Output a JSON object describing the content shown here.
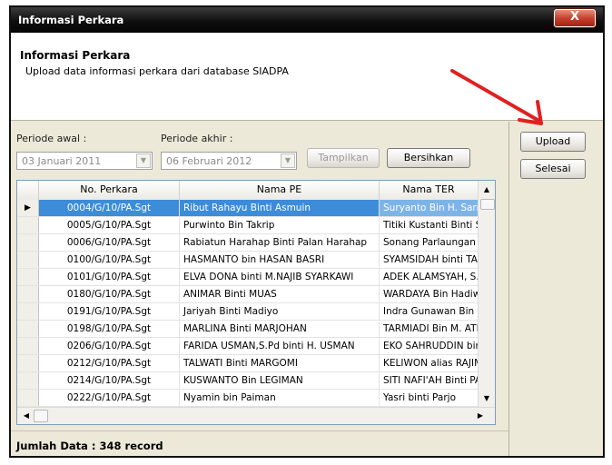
{
  "window": {
    "title": "Informasi Perkara",
    "close_glyph": "X"
  },
  "header": {
    "title": "Informasi Perkara",
    "subtitle": "Upload data informasi perkara dari database SIADPA"
  },
  "filters": {
    "periode_awal_label": "Periode awal :",
    "periode_akhir_label": "Periode akhir :",
    "periode_awal_value": "03  Januari   2011",
    "periode_akhir_value": "06  Februari  2012",
    "dropdown_icon": "chevron-down-icon"
  },
  "buttons": {
    "tampilkan": "Tampilkan",
    "bersihkan": "Bersihkan",
    "upload": "Upload",
    "selesai": "Selesai"
  },
  "table": {
    "columns": [
      "No. Perkara",
      "Nama PE",
      "Nama TER"
    ],
    "rows": [
      [
        "0004/G/10/PA.Sgt",
        "Ribut Rahayu Binti Asmuin",
        "Suryanto Bin H. Sarmin"
      ],
      [
        "0005/G/10/PA.Sgt",
        "Purwinto Bin Takrip",
        "Titiki Kustanti Binti Suwa"
      ],
      [
        "0006/G/10/PA.Sgt",
        "Rabiatun Harahap Binti Palan Harahap",
        "Sonang Parlaungan Bin"
      ],
      [
        "0100/G/10/PA.Sgt",
        "HASMANTO bin HASAN BASRI",
        "SYAMSIDAH binti TAFIA"
      ],
      [
        "0101/G/10/PA.Sgt",
        "ELVA DONA binti M.NAJIB SYARKAWI",
        "ADEK ALAMSYAH, S.Pt."
      ],
      [
        "0180/G/10/PA.Sgt",
        "ANIMAR Binti MUAS",
        "WARDAYA Bin Hadiwiry"
      ],
      [
        "0191/G/10/PA.Sgt",
        "Jariyah Binti Madiyo",
        "Indra Gunawan Bin Rud"
      ],
      [
        "0198/G/10/PA.Sgt",
        "MARLINA Binti MARJOHAN",
        "TARMIADI Bin M. ATIN"
      ],
      [
        "0206/G/10/PA.Sgt",
        "FARIDA USMAN,S.Pd binti H. USMAN",
        "EKO SAHRUDDIN bin an"
      ],
      [
        "0212/G/10/PA.Sgt",
        "TALWATI Binti MARGOMI",
        "KELIWON alias RAJIMAI"
      ],
      [
        "0214/G/10/PA.Sgt",
        "KUSWANTO Bin LEGIMAN",
        "SITI NAFI'AH Binti PAIM"
      ],
      [
        "0222/G/10/PA.Sgt",
        "Nyamin bin Paiman",
        "Yasri binti Parjo"
      ]
    ],
    "selected_row_index": 0,
    "selected_color": "#3c8cd9"
  },
  "footer": {
    "record_count_text": "Jumlah Data : 348 record"
  },
  "annotation": {
    "arrow_color": "#e02020"
  }
}
